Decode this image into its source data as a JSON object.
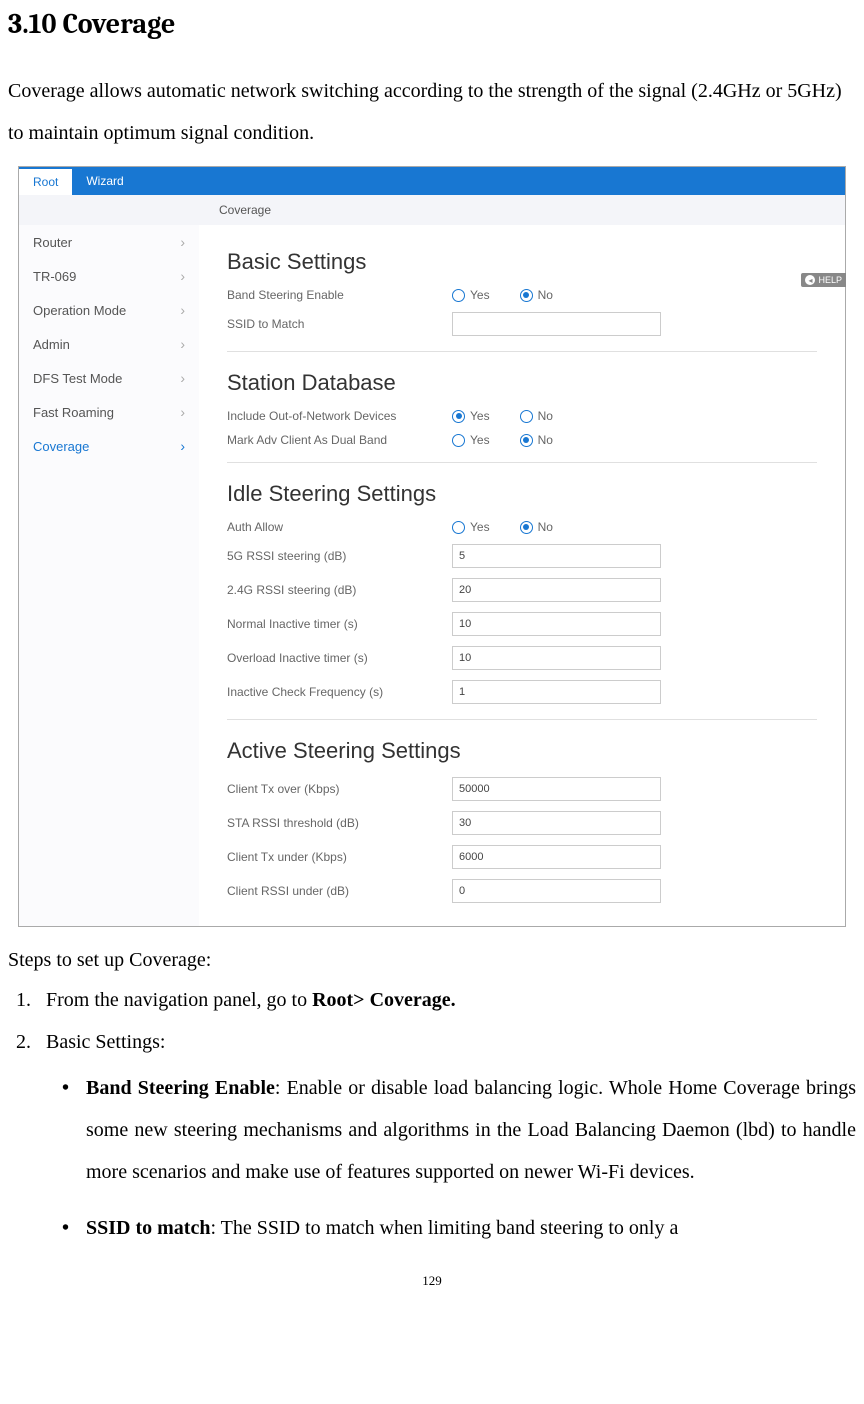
{
  "heading": "3.10 Coverage",
  "intro": "Coverage allows automatic network switching according to the strength of the signal (2.4GHz or 5GHz) to maintain optimum signal condition.",
  "screenshot": {
    "tabs": {
      "active": "Root",
      "other": "Wizard"
    },
    "breadcrumb": "Coverage",
    "help_label": "HELP",
    "sidebar": {
      "items": [
        {
          "label": "Router"
        },
        {
          "label": "TR-069"
        },
        {
          "label": "Operation Mode"
        },
        {
          "label": "Admin"
        },
        {
          "label": "DFS Test Mode"
        },
        {
          "label": "Fast Roaming"
        },
        {
          "label": "Coverage",
          "active": true
        }
      ]
    },
    "sections": {
      "basic": {
        "title": "Basic Settings",
        "band_steering_label": "Band Steering Enable",
        "band_steering_value": "No",
        "ssid_label": "SSID to Match",
        "ssid_value": ""
      },
      "station_db": {
        "title": "Station Database",
        "include_oon_label": "Include Out-of-Network Devices",
        "include_oon_value": "Yes",
        "mark_adv_label": "Mark Adv Client As Dual Band",
        "mark_adv_value": "No"
      },
      "idle": {
        "title": "Idle Steering Settings",
        "auth_allow_label": "Auth Allow",
        "auth_allow_value": "No",
        "rssi5g_label": "5G RSSI steering (dB)",
        "rssi5g_value": "5",
        "rssi24g_label": "2.4G RSSI steering (dB)",
        "rssi24g_value": "20",
        "normal_inactive_label": "Normal Inactive timer (s)",
        "normal_inactive_value": "10",
        "overload_inactive_label": "Overload Inactive timer (s)",
        "overload_inactive_value": "10",
        "inactive_check_label": "Inactive Check Frequency (s)",
        "inactive_check_value": "1"
      },
      "active": {
        "title": "Active Steering Settings",
        "tx_over_label": "Client Tx over (Kbps)",
        "tx_over_value": "50000",
        "sta_rssi_label": "STA RSSI threshold (dB)",
        "sta_rssi_value": "30",
        "tx_under_label": "Client Tx under (Kbps)",
        "tx_under_value": "6000",
        "client_rssi_under_label": "Client RSSI under (dB)",
        "client_rssi_under_value": "0"
      }
    },
    "yes": "Yes",
    "no": "No"
  },
  "steps_intro": "Steps to set up Coverage:",
  "step1_a": "From the navigation panel, go to ",
  "step1_b": "Root> Coverage.",
  "step2": "Basic Settings:",
  "bullet1_bold": "Band Steering Enable",
  "bullet1_text": ": Enable or disable load balancing logic. Whole Home Coverage brings some new steering mechanisms and algorithms in the Load Balancing Daemon (lbd) to handle more scenarios and make use of features supported on newer Wi-Fi devices.",
  "bullet2_bold": "SSID to match",
  "bullet2_text": ": The SSID to match when limiting band steering to only a",
  "page_number": "129"
}
